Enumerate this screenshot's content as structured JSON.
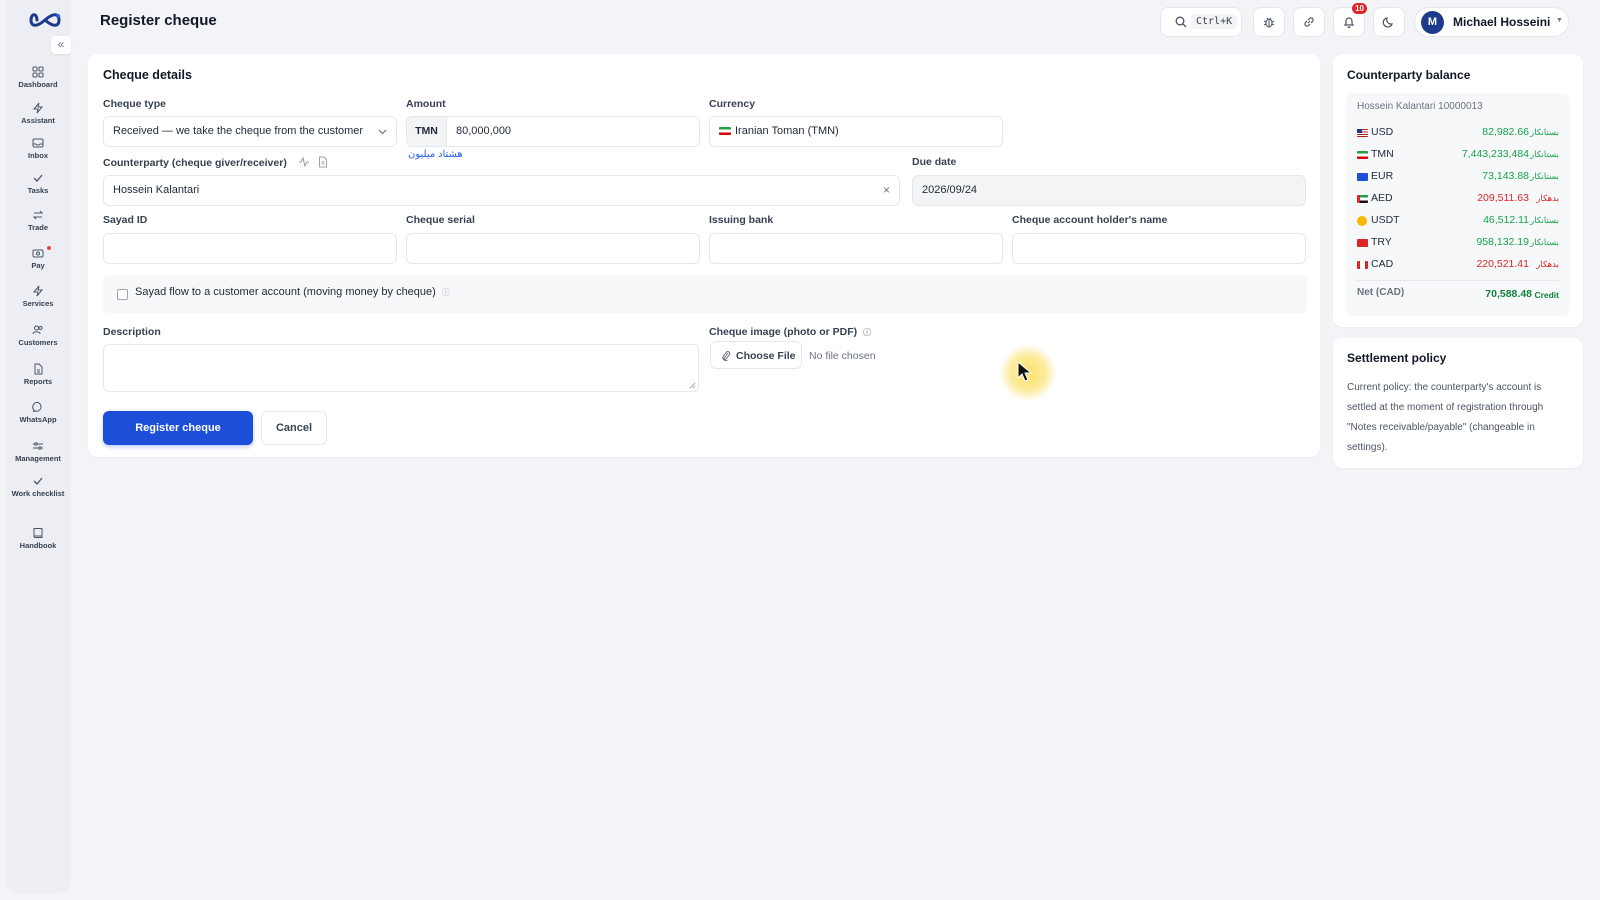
{
  "header": {
    "title": "Register cheque",
    "search_shortcut": "Ctrl+K",
    "notifications_count": "10",
    "user_initial": "M",
    "user_name": "Michael Hosseini"
  },
  "sidebar": {
    "items": [
      {
        "label": "Dashboard",
        "icon": "dashboard-icon"
      },
      {
        "label": "Assistant",
        "icon": "bolt-icon"
      },
      {
        "label": "Inbox",
        "icon": "inbox-icon"
      },
      {
        "label": "Tasks",
        "icon": "check-icon"
      },
      {
        "label": "Trade",
        "icon": "swap-icon"
      },
      {
        "label": "Pay",
        "icon": "wallet-icon"
      },
      {
        "label": "Services",
        "icon": "bolt-icon"
      },
      {
        "label": "Customers",
        "icon": "users-icon"
      },
      {
        "label": "Reports",
        "icon": "report-icon"
      },
      {
        "label": "WhatsApp",
        "icon": "chat-icon"
      },
      {
        "label": "Management",
        "icon": "sliders-icon"
      },
      {
        "label": "Work checklist",
        "icon": "check-icon"
      },
      {
        "label": "Handbook",
        "icon": "book-icon"
      }
    ]
  },
  "form": {
    "title": "Cheque details",
    "cheque_type_label": "Cheque type",
    "cheque_type_value": "Received — we take the cheque from the customer",
    "amount_label": "Amount",
    "amount_currency": "TMN",
    "amount_value": "80,000,000",
    "amount_words": "هشتاد میلیون",
    "currency_label": "Currency",
    "currency_value": "Iranian Toman (TMN)",
    "counterparty_label": "Counterparty (cheque giver/receiver)",
    "counterparty_value": "Hossein Kalantari",
    "due_date_label": "Due date",
    "due_date_value": "2026/09/24",
    "sayad_id_label": "Sayad ID",
    "cheque_serial_label": "Cheque serial",
    "issuing_bank_label": "Issuing bank",
    "holder_name_label": "Cheque account holder's name",
    "sayad_flow_label": "Sayad flow to a customer account (moving money by cheque)",
    "description_label": "Description",
    "image_label": "Cheque image (photo or PDF)",
    "choose_file_label": "Choose File",
    "no_file_text": "No file chosen",
    "submit_label": "Register cheque",
    "cancel_label": "Cancel"
  },
  "balance": {
    "title": "Counterparty balance",
    "account": "Hossein Kalantari 10000013",
    "rows": [
      {
        "currency": "USD",
        "amount": "82,982.66",
        "status": "بستانکار",
        "type": "credit"
      },
      {
        "currency": "TMN",
        "amount": "7,443,233,484",
        "status": "بستانکار",
        "type": "credit"
      },
      {
        "currency": "EUR",
        "amount": "73,143.88",
        "status": "بستانکار",
        "type": "credit"
      },
      {
        "currency": "AED",
        "amount": "209,511.63",
        "status": "بدهکار",
        "type": "debit"
      },
      {
        "currency": "USDT",
        "amount": "46,512.11",
        "status": "بستانکار",
        "type": "credit"
      },
      {
        "currency": "TRY",
        "amount": "958,132.19",
        "status": "بستانکار",
        "type": "credit"
      },
      {
        "currency": "CAD",
        "amount": "220,521.41",
        "status": "بدهکار",
        "type": "debit"
      }
    ],
    "net_label": "Net (CAD)",
    "net_value": "70,588.48",
    "net_status": "Credit"
  },
  "policy": {
    "title": "Settlement policy",
    "text": "Current policy: the counterparty's account is settled at the moment of registration through \"Notes receivable/payable\" (changeable in settings)."
  },
  "colors": {
    "primary": "#1d4ed8",
    "credit": "#16a34a",
    "debit": "#dc2626",
    "notification_badge": "#dc2626"
  }
}
